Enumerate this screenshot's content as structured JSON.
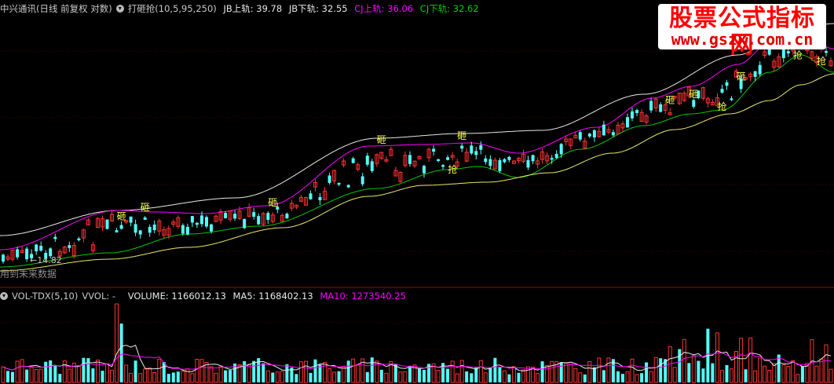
{
  "price_panel": {
    "stock_label": "中兴通讯(日线 前复权 对数)",
    "indicator_label": "打砸抢(10,5,95,250)",
    "jb_upper_label": "JB上轨:",
    "jb_upper_value": "39.78",
    "jb_lower_label": "JB下轨:",
    "jb_lower_value": "32.55",
    "cj_upper_label": "CJ上轨:",
    "cj_upper_value": "36.06",
    "cj_lower_label": "CJ下轨:",
    "cj_lower_value": "32.62",
    "low_marker": "14.82",
    "bottom_label": "用到未来数据",
    "sell_mark": "砸",
    "buy_mark": "抢"
  },
  "volume_panel": {
    "indicator_label": "VOL-TDX(5,10)",
    "vvol_label": "VVOL: -",
    "volume_label": "VOLUME:",
    "volume_value": "1166012.13",
    "ma5_label": "MA5:",
    "ma5_value": "1168402.13",
    "ma10_label": "MA10:",
    "ma10_value": "1273540.25"
  },
  "watermark": {
    "line1": "股票公式指标网",
    "line2": "www.gszx.com.cn"
  },
  "colors": {
    "up": "#ff3232",
    "down": "#54fcfc",
    "jb_rail": "#e8e8e8",
    "cj_upper": "#ff00ff",
    "cj_lower": "#00c800",
    "ma_yellow": "#e8e86a",
    "signal": "#ffff54",
    "separator": "#b00000",
    "ma10_text": "#ff00ff"
  },
  "chart_data": [
    {
      "type": "candlestick",
      "title": "打砸抢(10,5,95,250)",
      "x_count": 176,
      "scale": "log",
      "annotations": [
        {
          "text": "砸",
          "type": "sell",
          "index": 25
        },
        {
          "text": "砸",
          "type": "sell",
          "index": 30
        },
        {
          "text": "砸",
          "type": "sell",
          "index": 57
        },
        {
          "text": "砸",
          "type": "sell",
          "index": 80
        },
        {
          "text": "抢",
          "type": "buy",
          "index": 95
        },
        {
          "text": "砸",
          "type": "sell",
          "index": 97
        },
        {
          "text": "砸",
          "type": "sell",
          "index": 141
        },
        {
          "text": "砸",
          "type": "sell",
          "index": 146
        },
        {
          "text": "抢",
          "type": "buy",
          "index": 152
        },
        {
          "text": "砸",
          "type": "sell",
          "index": 156
        },
        {
          "text": "抢",
          "type": "buy",
          "index": 168
        },
        {
          "text": "抢",
          "type": "buy",
          "index": 173
        }
      ],
      "marked_low": 14.82,
      "last_values": {
        "jb_upper": 39.78,
        "jb_lower": 32.55,
        "cj_upper": 36.06,
        "cj_lower": 32.62
      }
    },
    {
      "type": "bar",
      "title": "VOL-TDX(5,10)",
      "x_count": 176,
      "series": [
        {
          "name": "VOLUME",
          "last": 1166012.13
        },
        {
          "name": "MA5",
          "last": 1168402.13
        },
        {
          "name": "MA10",
          "last": 1273540.25
        }
      ]
    }
  ]
}
